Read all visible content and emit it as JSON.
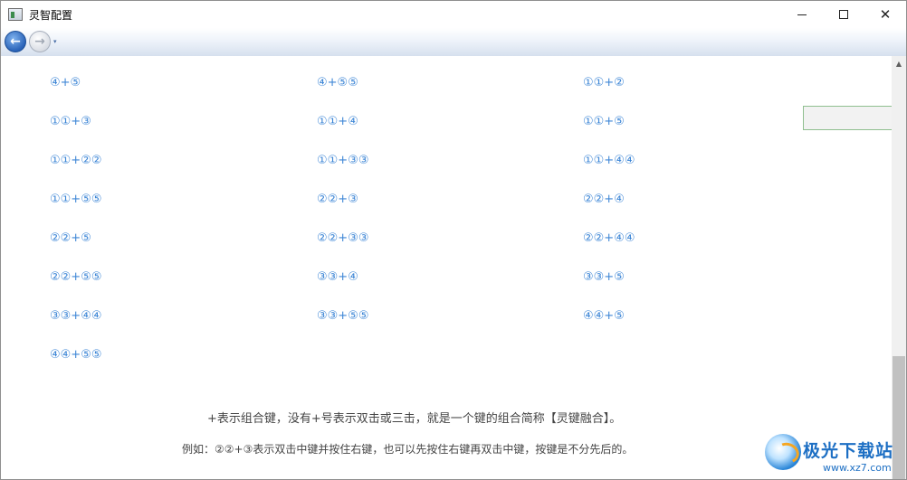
{
  "window": {
    "title": "灵智配置",
    "icons": {
      "app": "app-window-icon",
      "minimize": "minimize-icon",
      "maximize": "maximize-icon",
      "close": "close-icon"
    },
    "close_glyph": "✕"
  },
  "nav": {
    "back_glyph": "←",
    "forward_glyph": "→",
    "dropdown_glyph": "▾",
    "icons": {
      "back": "back-arrow-icon",
      "forward": "forward-arrow-icon",
      "dropdown": "chevron-down-icon"
    }
  },
  "combos": [
    "④+⑤",
    "④+⑤⑤",
    "①①+②",
    "①①+③",
    "①①+④",
    "①①+⑤",
    "①①+②②",
    "①①+③③",
    "①①+④④",
    "①①+⑤⑤",
    "②②+③",
    "②②+④",
    "②②+⑤",
    "②②+③③",
    "②②+④④",
    "②②+⑤⑤",
    "③③+④",
    "③③+⑤",
    "③③+④④",
    "③③+⑤⑤",
    "④④+⑤",
    "④④+⑤⑤"
  ],
  "notes": {
    "legend": "+表示组合键，没有+号表示双击或三击，就是一个键的组合简称【灵键融合】。",
    "example": "例如：②②+③表示双击中键并按住右键，也可以先按住右键再双击中键，按键是不分先后的。"
  },
  "scrollbar": {
    "up_glyph": "▲"
  },
  "watermark": {
    "name": "极光下载站",
    "url": "www.xz7.com"
  },
  "colors": {
    "link": "#3d86d6",
    "text": "#444444"
  }
}
